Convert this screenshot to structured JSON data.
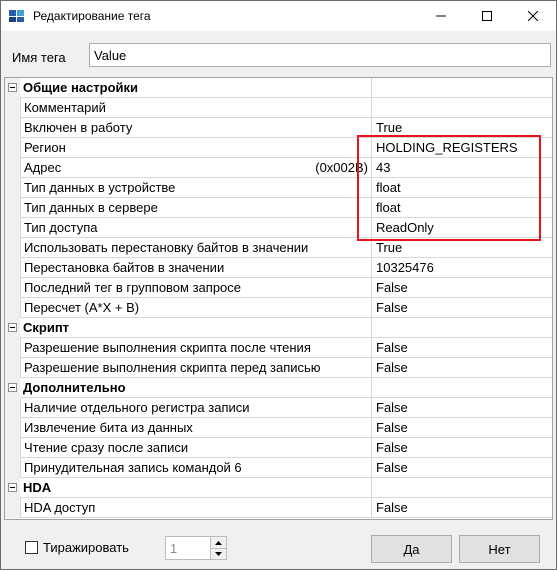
{
  "window": {
    "title": "Редактирование тега",
    "icon": "app-logo-icon"
  },
  "tag_name": {
    "label": "Имя тега",
    "value": "Value"
  },
  "properties": [
    {
      "type": "category",
      "name": "Общие настройки"
    },
    {
      "type": "prop",
      "name": "Комментарий",
      "value": ""
    },
    {
      "type": "prop",
      "name": "Включен в работу",
      "value": "True"
    },
    {
      "type": "prop",
      "name": "Регион",
      "value": "HOLDING_REGISTERS"
    },
    {
      "type": "prop",
      "name": "Адрес",
      "extra": "(0x002B)",
      "value": "43"
    },
    {
      "type": "prop",
      "name": "Тип данных в устройстве",
      "value": "float"
    },
    {
      "type": "prop",
      "name": "Тип данных в сервере",
      "value": "float"
    },
    {
      "type": "prop",
      "name": "Тип доступа",
      "value": "ReadOnly"
    },
    {
      "type": "prop",
      "name": "Использовать перестановку байтов в значении",
      "value": "True"
    },
    {
      "type": "prop",
      "name": "Перестановка байтов в значении",
      "value": "10325476"
    },
    {
      "type": "prop",
      "name": "Последний тег в групповом запросе",
      "value": "False"
    },
    {
      "type": "prop",
      "name": "Пересчет (A*X + B)",
      "value": "False"
    },
    {
      "type": "category",
      "name": "Скрипт"
    },
    {
      "type": "prop",
      "name": "Разрешение выполнения скрипта после чтения",
      "value": "False"
    },
    {
      "type": "prop",
      "name": "Разрешение выполнения скрипта перед записью",
      "value": "False"
    },
    {
      "type": "category",
      "name": "Дополнительно"
    },
    {
      "type": "prop",
      "name": "Наличие отдельного регистра записи",
      "value": "False"
    },
    {
      "type": "prop",
      "name": "Извлечение бита из данных",
      "value": "False"
    },
    {
      "type": "prop",
      "name": "Чтение сразу после записи",
      "value": "False"
    },
    {
      "type": "prop",
      "name": "Принудительная запись командой 6",
      "value": "False"
    },
    {
      "type": "category",
      "name": "HDA"
    },
    {
      "type": "prop",
      "name": "HDA доступ",
      "value": "False"
    }
  ],
  "footer": {
    "replicate_label": "Тиражировать",
    "replicate_checked": false,
    "count_value": "1",
    "ok_label": "Да",
    "cancel_label": "Нет"
  },
  "colors": {
    "highlight": "#e8141b"
  }
}
